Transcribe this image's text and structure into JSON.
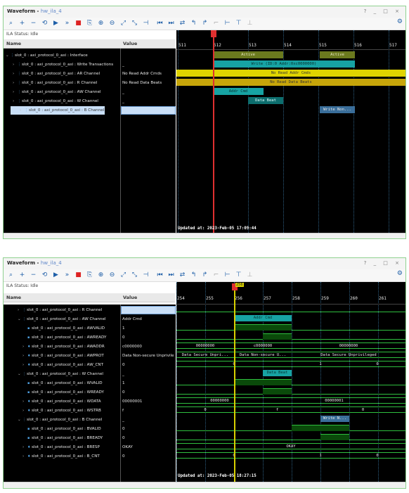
{
  "window": {
    "title": "Waveform",
    "subtitle": "hw_ila_4",
    "controls": "? _ □ ×"
  },
  "status": "ILA Status: Idle",
  "columns": {
    "name": "Name",
    "value": "Value"
  },
  "colors": {
    "accent": "#5f87c9",
    "olive": "#6b7a1e",
    "teal": "#17a3a3",
    "yellow": "#e0d400",
    "gold": "#c7a60a",
    "cursor_red": "#e03030",
    "cursor_yellow": "#d8d000"
  },
  "panel1": {
    "rows": [
      {
        "name": "slot_0 : axi_protocol_0_axi : Interface",
        "value": ""
      },
      {
        "name": "slot_0 : axi_protocol_0_axi : Write Transactions",
        "value": "_"
      },
      {
        "name": "slot_0 : axi_protocol_0_axi : AR Channel",
        "value": "No Read Addr Cmds"
      },
      {
        "name": "slot_0 : axi_protocol_0_axi : R Channel",
        "value": "No Read Data Beats"
      },
      {
        "name": "slot_0 : axi_protocol_0_axi : AW Channel",
        "value": "_"
      },
      {
        "name": "slot_0 : axi_protocol_0_axi : W Channel",
        "value": "_"
      },
      {
        "name": "slot_0 : axi_protocol_0_axi : B Channel",
        "value": "_"
      }
    ],
    "ticks": [
      "511",
      "512",
      "513",
      "514",
      "515",
      "516",
      "517"
    ],
    "segments": [
      {
        "label": "Active"
      },
      {
        "label": "Active"
      },
      {
        "label": "Write (ID:0 Addr:0xc0000000)"
      },
      {
        "label": "No Read Addr Cmds"
      },
      {
        "label": "No Read Data Beats"
      },
      {
        "label": "Addr Cmd"
      },
      {
        "label": "Data Beat"
      },
      {
        "label": "Write Non..."
      }
    ],
    "updated": "Updated at: 2023-Feb-05 17:09:44"
  },
  "panel2": {
    "rows": [
      {
        "name": "slot_0 : axi_protocol_0_axi : R Channel",
        "value": "_"
      },
      {
        "name": "slot_0 : axi_protocol_0_axi : AW Channel",
        "value": "Addr Cmd"
      },
      {
        "name": "slot_0 : axi_protocol_0_axi : AWVALID",
        "value": "1"
      },
      {
        "name": "slot_0 : axi_protocol_0_axi : AWREADY",
        "value": "0"
      },
      {
        "name": "slot_0 : axi_protocol_0_axi : AWADDR",
        "value": "c0000000"
      },
      {
        "name": "slot_0 : axi_protocol_0_axi : AWPROT",
        "value": "Data Non-secure Unprivile"
      },
      {
        "name": "slot_0 : axi_protocol_0_axi : AW_CNT",
        "value": "0"
      },
      {
        "name": "slot_0 : axi_protocol_0_axi : W Channel",
        "value": "_"
      },
      {
        "name": "slot_0 : axi_protocol_0_axi : WVALID",
        "value": "1"
      },
      {
        "name": "slot_0 : axi_protocol_0_axi : WREADY",
        "value": "0"
      },
      {
        "name": "slot_0 : axi_protocol_0_axi : WDATA",
        "value": "00000001"
      },
      {
        "name": "slot_0 : axi_protocol_0_axi : WSTRB",
        "value": "f"
      },
      {
        "name": "slot_0 : axi_protocol_0_axi : B Channel",
        "value": "_"
      },
      {
        "name": "slot_0 : axi_protocol_0_axi : BVALID",
        "value": "0"
      },
      {
        "name": "slot_0 : axi_protocol_0_axi : BREADY",
        "value": "0"
      },
      {
        "name": "slot_0 : axi_protocol_0_axi : BRESP",
        "value": "OKAY"
      },
      {
        "name": "slot_0 : axi_protocol_0_axi : B_CNT",
        "value": "0"
      }
    ],
    "ticks": [
      "254",
      "255",
      "256",
      "257",
      "258",
      "259",
      "260",
      "261"
    ],
    "cursor_label": "256",
    "labels": {
      "aw": "Addr Cmd",
      "awaddr": [
        "00000000",
        "c0000000",
        "00000000"
      ],
      "awprot": [
        "Data Secure Unpri...",
        "Data Non-secure U...",
        "Data Secure Unprivileged"
      ],
      "awcnt": [
        "0",
        "1",
        "0"
      ],
      "w": "Data Beat",
      "wdata": [
        "00000000",
        "00000001"
      ],
      "wstrb": [
        "0",
        "f",
        "0"
      ],
      "b": "Write N...",
      "bresp": "OKAY",
      "bcnt": [
        "0",
        "1",
        "0"
      ]
    },
    "updated": "Updated at: 2023-Feb-05 18:27:15"
  }
}
